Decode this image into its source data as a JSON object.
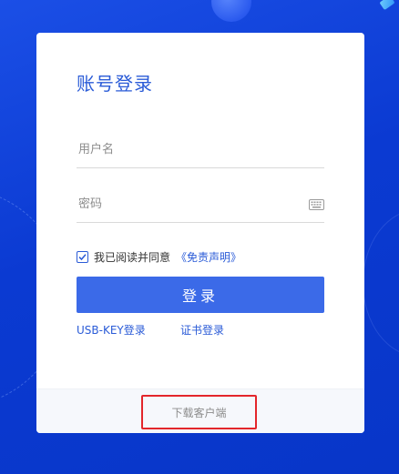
{
  "login": {
    "title": "账号登录",
    "username_placeholder": "用户名",
    "username_value": "",
    "password_placeholder": "密码",
    "password_value": "",
    "keyboard_icon": "keyboard-icon",
    "agree_checked": true,
    "agree_text": "我已阅读并同意",
    "agree_link": "《免责声明》",
    "submit_label": "登录",
    "usb_key_link": "USB-KEY登录",
    "cert_link": "证书登录",
    "download_label": "下载客户端"
  },
  "colors": {
    "background": "#0b3fd6",
    "accent": "#2a5bd7",
    "button": "#3b6ae8",
    "highlight_border": "#e3262b"
  }
}
